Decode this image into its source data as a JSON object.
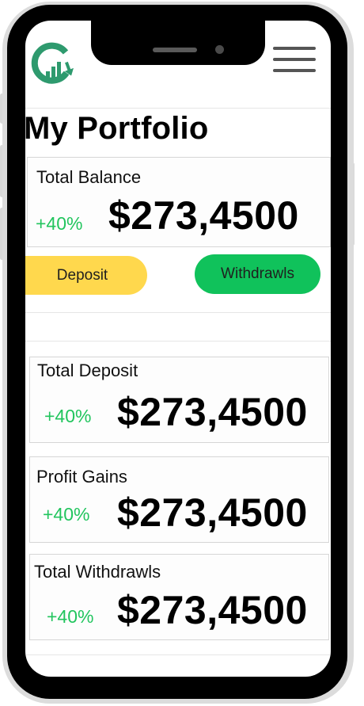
{
  "app": {
    "logo_icon": "growth-chart-logo-icon",
    "menu_icon": "hamburger-menu-icon",
    "brand_color": "#2e9a6e"
  },
  "page": {
    "title": "My Portfolio"
  },
  "balance": {
    "label": "Total Balance",
    "change": "+40%",
    "amount": "$273,4500"
  },
  "actions": {
    "deposit_label": "Deposit",
    "withdraw_label": "Withdrawls",
    "deposit_color": "#ffd84d",
    "withdraw_color": "#10c25b"
  },
  "cards": [
    {
      "label": "Total Deposit",
      "change": "+40%",
      "amount": "$273,4500"
    },
    {
      "label": "Profit Gains",
      "change": "+40%",
      "amount": "$273,4500"
    },
    {
      "label": "Total Withdrawls",
      "change": "+40%",
      "amount": "$273,4500"
    }
  ],
  "colors": {
    "positive": "#22c55e"
  }
}
